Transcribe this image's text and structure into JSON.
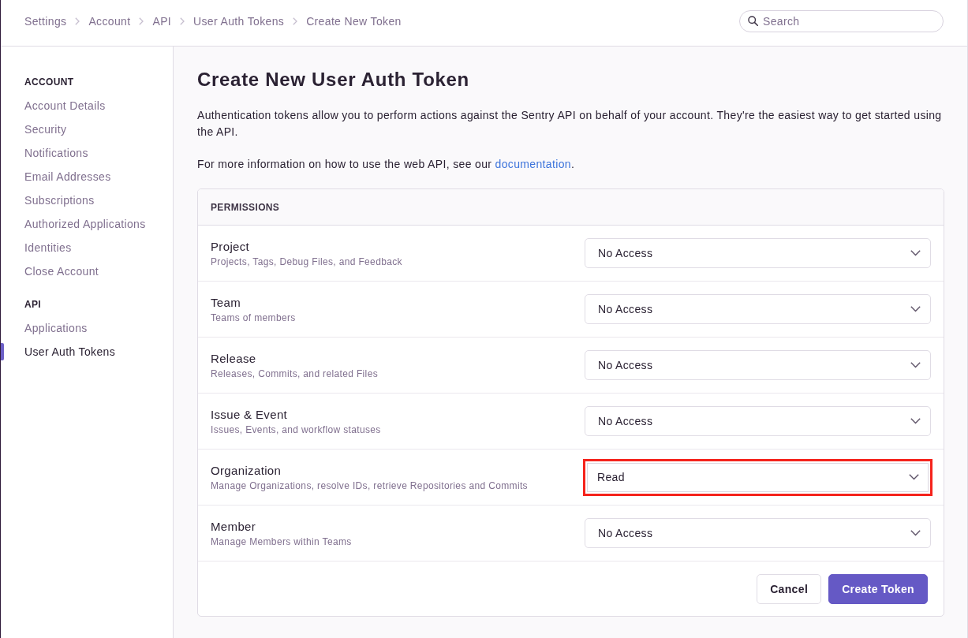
{
  "breadcrumbs": [
    "Settings",
    "Account",
    "API",
    "User Auth Tokens",
    "Create New Token"
  ],
  "search": {
    "placeholder": "Search"
  },
  "sidebar": {
    "sections": [
      {
        "heading": "ACCOUNT",
        "items": [
          {
            "label": "Account Details",
            "selected": false
          },
          {
            "label": "Security",
            "selected": false
          },
          {
            "label": "Notifications",
            "selected": false
          },
          {
            "label": "Email Addresses",
            "selected": false
          },
          {
            "label": "Subscriptions",
            "selected": false
          },
          {
            "label": "Authorized Applications",
            "selected": false
          },
          {
            "label": "Identities",
            "selected": false
          },
          {
            "label": "Close Account",
            "selected": false
          }
        ]
      },
      {
        "heading": "API",
        "items": [
          {
            "label": "Applications",
            "selected": false
          },
          {
            "label": "User Auth Tokens",
            "selected": true
          }
        ]
      }
    ]
  },
  "page": {
    "title": "Create New User Auth Token",
    "description": "Authentication tokens allow you to perform actions against the Sentry API on behalf of your account. They're the easiest way to get started using the API.",
    "info": {
      "text": "For more information on how to use the web API, see our",
      "link": "documentation",
      "after": "."
    }
  },
  "permissions": {
    "heading": "PERMISSIONS",
    "rows": [
      {
        "name": "Project",
        "description": "Projects, Tags, Debug Files, and Feedback",
        "value": "No Access",
        "highlighted": false
      },
      {
        "name": "Team",
        "description": "Teams of members",
        "value": "No Access",
        "highlighted": false
      },
      {
        "name": "Release",
        "description": "Releases, Commits, and related Files",
        "value": "No Access",
        "highlighted": false
      },
      {
        "name": "Issue & Event",
        "description": "Issues, Events, and workflow statuses",
        "value": "No Access",
        "highlighted": false
      },
      {
        "name": "Organization",
        "description": "Manage Organizations, resolve IDs, retrieve Repositories and Commits",
        "value": "Read",
        "highlighted": true
      },
      {
        "name": "Member",
        "description": "Manage Members within Teams",
        "value": "No Access",
        "highlighted": false
      }
    ]
  },
  "buttons": [
    {
      "label": "Cancel",
      "kind": "secondary"
    },
    {
      "label": "Create Token",
      "kind": "primary"
    }
  ]
}
